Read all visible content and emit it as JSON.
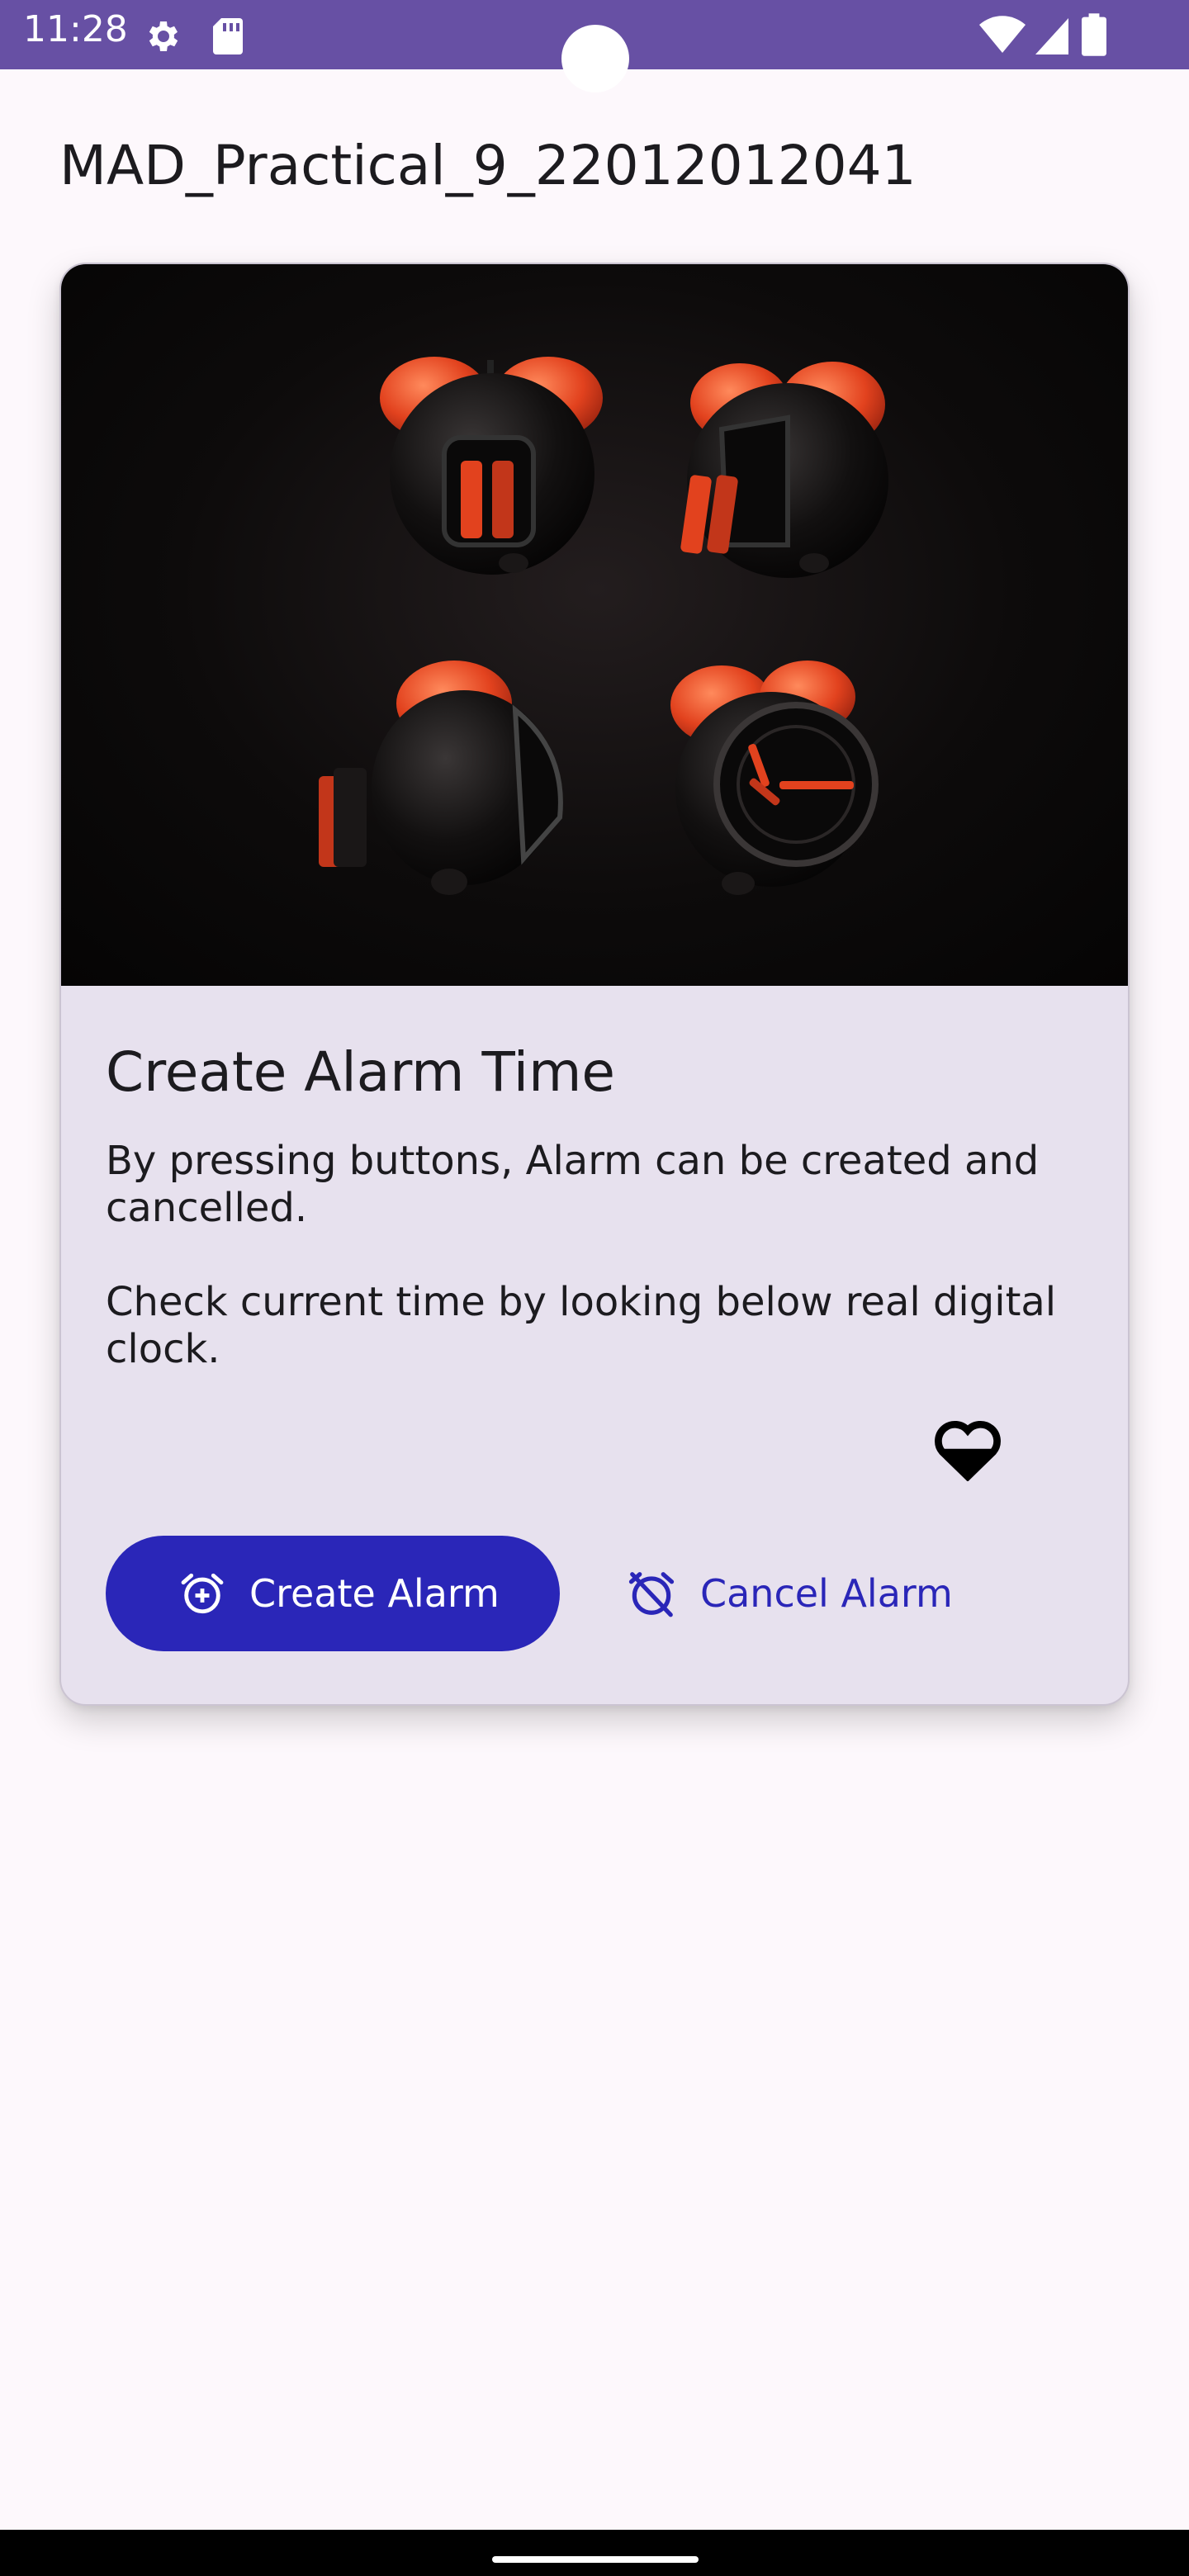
{
  "status_bar": {
    "time": "11:28",
    "icons": [
      "gear-icon",
      "sd-card-icon",
      "wifi-icon",
      "signal-icon",
      "battery-icon"
    ],
    "background": "#6750a4"
  },
  "page": {
    "title": "MAD_Practical_9_22012012041"
  },
  "card": {
    "image_icon": "alarm-clocks-image",
    "title": "Create Alarm Time",
    "description": "By pressing buttons, Alarm can be created and cancelled.\n\nCheck current time by looking below real digital clock.",
    "heart_icon": "heart-half-icon",
    "create_button_label": "Create Alarm",
    "cancel_button_label": "Cancel Alarm",
    "accent": "#2a26b8",
    "surface": "#e7e1ee"
  },
  "nav": {
    "handle": "gesture-handle"
  }
}
